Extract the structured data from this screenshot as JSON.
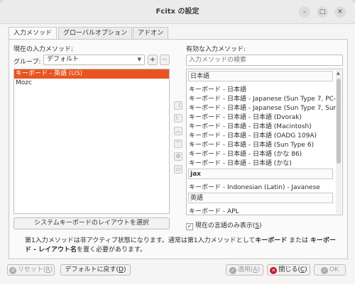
{
  "window": {
    "title": "Fcitx の設定",
    "minimize": "–",
    "maximize": "□",
    "close": "✕"
  },
  "tabs": [
    {
      "label": "入力メソッド",
      "active": true
    },
    {
      "label": "グローバルオプション",
      "active": false
    },
    {
      "label": "アドオン",
      "active": false
    }
  ],
  "current": {
    "label": "現在の入力メソッド:",
    "group_label": "グループ:",
    "group_value": "デフォルト",
    "add": "+",
    "remove": "−",
    "items": [
      {
        "name": "キーボード - 英語",
        "suffix": " (US)",
        "selected": true
      },
      {
        "name": "Mozc",
        "suffix": "",
        "selected": false
      }
    ],
    "layout_button": "システムキーボードのレイアウトを選択"
  },
  "available": {
    "label": "有効な入力メソッド:",
    "search_placeholder": "入力メソッドの検索",
    "groups": [
      {
        "header": "日本語",
        "items": [
          "キーボード - 日本語",
          "キーボード - 日本語 - Japanese (Sun Type 7, PC-c...",
          "キーボード - 日本語 - Japanese (Sun Type 7, Sun-...",
          "キーボード - 日本語 - 日本語 (Dvorak)",
          "キーボード - 日本語 - 日本語 (Macintosh)",
          "キーボード - 日本語 - 日本語 (OADG 109A)",
          "キーボード - 日本語 - 日本語 (Sun Type 6)",
          "キーボード - 日本語 - 日本語 (かな 86)",
          "キーボード - 日本語 - 日本語 (かな)"
        ]
      },
      {
        "header": "jax",
        "items": [
          "キーボード - Indonesian (Latin) - Javanese"
        ]
      },
      {
        "header": "英語",
        "items": [
          "キーボード - APL"
        ]
      }
    ],
    "only_current_lang": "現在の言語のみ表示(",
    "only_current_key": "S",
    "only_current_close": ")",
    "checkmark": "✓"
  },
  "middle_buttons": [
    "〈",
    "〉",
    "︿",
    "﹀",
    "⚙",
    "▭"
  ],
  "note": {
    "line1_prefix": "第1入力メソッドは非アクティブ状態になります。通常は第1入力メソッドとして",
    "bold1": "キーボード",
    "line1_mid": " または ",
    "bold2a": "キーボー",
    "bold2b": "ド - レイアウト名",
    "line2_suffix": "を置く必要があります。"
  },
  "footer": {
    "reset": "リセット(",
    "reset_key": "R",
    "reset_close": ")",
    "defaults": "デフォルトに戻す(",
    "defaults_key": "D",
    "defaults_close": ")",
    "apply": "適用(",
    "apply_key": "A",
    "apply_close": ")",
    "close": "閉じる(",
    "close_key": "C",
    "close_close": ")",
    "ok": "OK"
  },
  "colors": {
    "selection": "#e95420",
    "close_icon": "#c01c28"
  }
}
